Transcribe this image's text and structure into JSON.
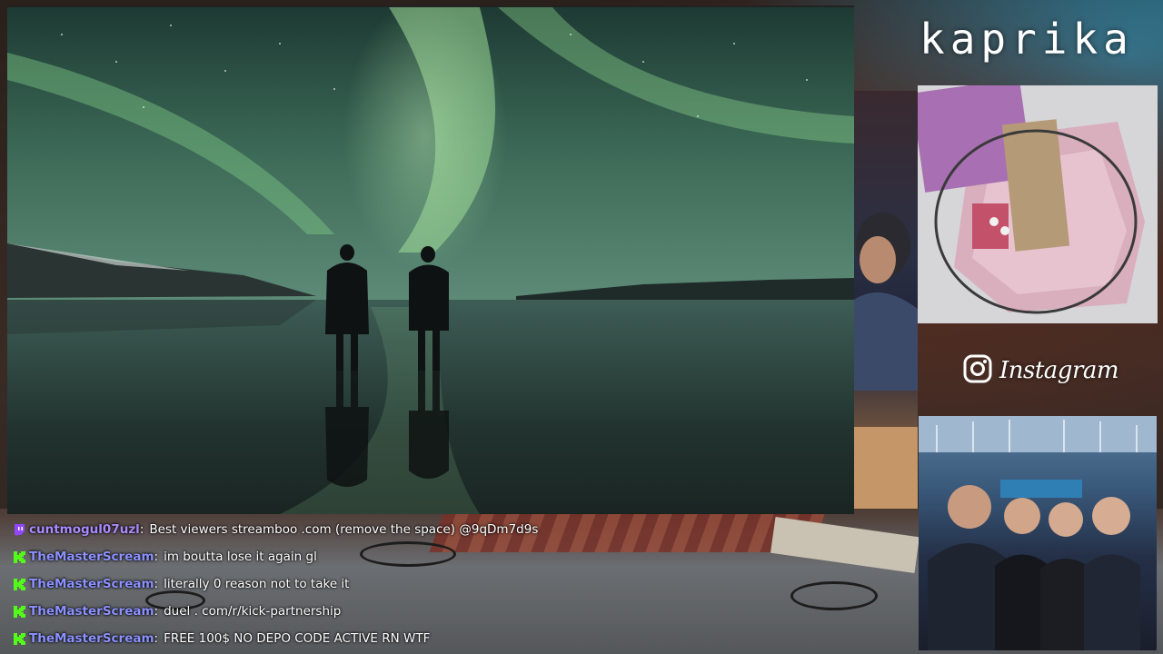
{
  "overlay": {
    "streamer_name": "kaprika",
    "instagram_label": "Instagram",
    "icons": {
      "instagram": "instagram-icon",
      "twitch": "twitch-icon",
      "kick": "kick-icon"
    },
    "colors": {
      "kick_green": "#53fc18",
      "twitch_purple": "#9146ff",
      "username_purple": "#a98bff",
      "username_blue": "#8b91ff"
    }
  },
  "chat": {
    "messages": [
      {
        "platform": "twitch",
        "user": "cuntmogul07uzl",
        "text": "Best viewers streamboo .com (remove the space) @9qDm7d9s"
      },
      {
        "platform": "kick",
        "user": "TheMasterScream",
        "text": "im boutta lose it again gl"
      },
      {
        "platform": "kick",
        "user": "TheMasterScream",
        "text": "literally 0 reason not to take it"
      },
      {
        "platform": "kick",
        "user": "TheMasterScream",
        "text": "duel . com/r/kick-partnership"
      },
      {
        "platform": "kick",
        "user": "TheMasterScream",
        "text": "FREE 100$ NO DEPO CODE ACTIVE RN WTF"
      }
    ]
  }
}
